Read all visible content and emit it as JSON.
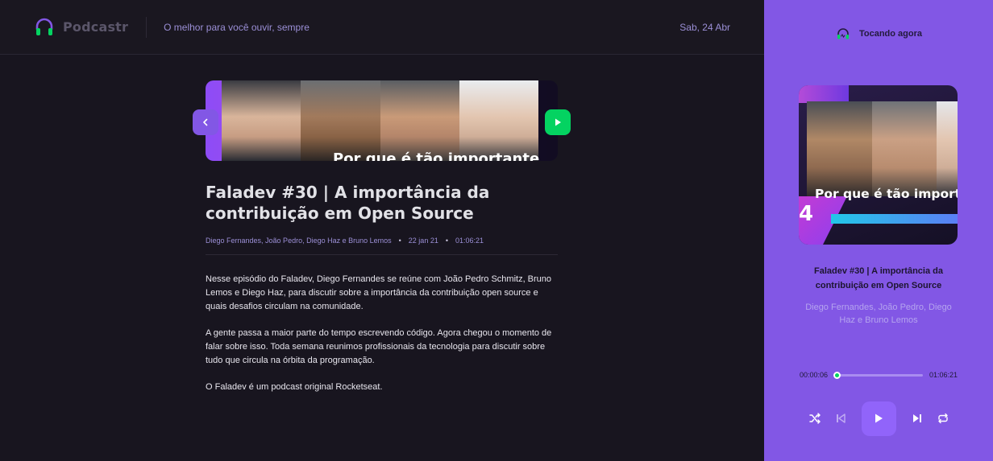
{
  "header": {
    "app_name": "Podcastr",
    "tagline": "O melhor para você ouvir, sempre",
    "date": "Sab, 24 Abr"
  },
  "episode": {
    "thumbnail_caption": "Por que é tão importante",
    "title": "Faladev #30 | A importância da contribuição em Open Source",
    "members": "Diego Fernandes, João Pedro, Diego Haz e Bruno Lemos",
    "published_at": "22 jan 21",
    "duration": "01:06:21",
    "description": [
      "Nesse episódio do Faladev, Diego Fernandes se reúne com João Pedro Schmitz, Bruno Lemos e Diego Haz, para discutir sobre a importância da contribuição open source e quais desafios circulam na comunidade.",
      "A gente passa a maior parte do tempo escrevendo código. Agora chegou o momento de falar sobre isso. Toda semana reunimos profissionais da tecnologia para discutir sobre tudo que circula na órbita da programação.",
      "O Faladev é um podcast original Rocketseat."
    ]
  },
  "player": {
    "header_label": "Tocando agora",
    "cover_caption": "Por que é tão importante contribuir em Open Source",
    "cover_number": "4",
    "title": "Faladev #30 | A importância da contribuição em Open Source",
    "members": "Diego Fernandes, João Pedro, Diego Haz e Bruno Lemos",
    "current_time": "00:00:06",
    "total_time": "01:06:21",
    "progress": 0.0015,
    "controls": [
      "shuffle-icon",
      "previous-icon",
      "play-icon",
      "next-icon",
      "repeat-icon"
    ]
  },
  "colors": {
    "brand_purple": "#8257e5",
    "accent_green": "#04d361",
    "background": "#18151f"
  }
}
